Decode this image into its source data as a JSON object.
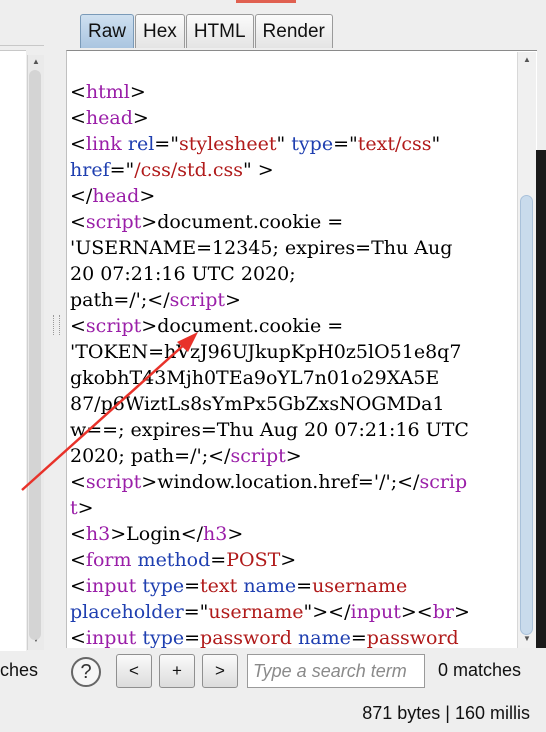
{
  "tabs": [
    {
      "label": "Raw",
      "active": true
    },
    {
      "label": "Hex",
      "active": false
    },
    {
      "label": "HTML",
      "active": false
    },
    {
      "label": "Render",
      "active": false
    }
  ],
  "code_lines": [
    [
      {
        "t": "<"
      },
      {
        "t": "html",
        "c": "tag"
      },
      {
        "t": ">"
      }
    ],
    [
      {
        "t": "<"
      },
      {
        "t": "head",
        "c": "tag"
      },
      {
        "t": ">"
      }
    ],
    [
      {
        "t": "<"
      },
      {
        "t": "link",
        "c": "tag"
      },
      {
        "t": " "
      },
      {
        "t": "rel",
        "c": "attr"
      },
      {
        "t": "=\""
      },
      {
        "t": "stylesheet",
        "c": "val"
      },
      {
        "t": "\" "
      },
      {
        "t": "type",
        "c": "attr"
      },
      {
        "t": "=\""
      },
      {
        "t": "text/css",
        "c": "val"
      },
      {
        "t": "\""
      }
    ],
    [
      {
        "t": "href",
        "c": "attr"
      },
      {
        "t": "=\""
      },
      {
        "t": "/css/std.css",
        "c": "val"
      },
      {
        "t": "\" >"
      }
    ],
    [
      {
        "t": "</"
      },
      {
        "t": "head",
        "c": "tag"
      },
      {
        "t": ">"
      }
    ],
    [
      {
        "t": "<"
      },
      {
        "t": "script",
        "c": "tag"
      },
      {
        "t": ">document.cookie ="
      }
    ],
    [
      {
        "t": "'USERNAME=12345; expires=Thu Aug"
      }
    ],
    [
      {
        "t": "20 07:21:16 UTC 2020;"
      }
    ],
    [
      {
        "t": "path=/';</"
      },
      {
        "t": "script",
        "c": "tag"
      },
      {
        "t": ">"
      }
    ],
    [
      {
        "t": "<"
      },
      {
        "t": "script",
        "c": "tag"
      },
      {
        "t": ">document.cookie ="
      }
    ],
    [
      {
        "t": "'TOKEN=hVzJ96UJkupKpH0z5lO51e8q7"
      }
    ],
    [
      {
        "t": "gkobhT43Mjh0TEa9oYL7n01o29XA5E"
      }
    ],
    [
      {
        "t": "87/p6WiztLs8sYmPx5GbZxsNOGMDa1"
      }
    ],
    [
      {
        "t": "w==; expires=Thu Aug 20 07:21:16 UTC"
      }
    ],
    [
      {
        "t": "2020; path=/';</"
      },
      {
        "t": "script",
        "c": "tag"
      },
      {
        "t": ">"
      }
    ],
    [
      {
        "t": "<"
      },
      {
        "t": "script",
        "c": "tag"
      },
      {
        "t": ">window.location.href='/';</"
      },
      {
        "t": "scrip",
        "c": "tag"
      }
    ],
    [
      {
        "t": "t",
        "c": "tag"
      },
      {
        "t": ">"
      }
    ],
    [
      {
        "t": "<"
      },
      {
        "t": "h3",
        "c": "tag"
      },
      {
        "t": ">Login</"
      },
      {
        "t": "h3",
        "c": "tag"
      },
      {
        "t": ">"
      }
    ],
    [
      {
        "t": "<"
      },
      {
        "t": "form",
        "c": "tag"
      },
      {
        "t": " "
      },
      {
        "t": "method",
        "c": "attr"
      },
      {
        "t": "="
      },
      {
        "t": "POST",
        "c": "val"
      },
      {
        "t": ">"
      }
    ],
    [
      {
        "t": "<"
      },
      {
        "t": "input",
        "c": "tag"
      },
      {
        "t": " "
      },
      {
        "t": "type",
        "c": "attr"
      },
      {
        "t": "="
      },
      {
        "t": "text",
        "c": "val"
      },
      {
        "t": " "
      },
      {
        "t": "name",
        "c": "attr"
      },
      {
        "t": "="
      },
      {
        "t": "username",
        "c": "val"
      }
    ],
    [
      {
        "t": "placeholder",
        "c": "attr"
      },
      {
        "t": "=\""
      },
      {
        "t": "username",
        "c": "val"
      },
      {
        "t": "\"></"
      },
      {
        "t": "input",
        "c": "tag"
      },
      {
        "t": "><"
      },
      {
        "t": "br",
        "c": "tag"
      },
      {
        "t": ">"
      }
    ],
    [
      {
        "t": "<"
      },
      {
        "t": "input",
        "c": "tag"
      },
      {
        "t": " "
      },
      {
        "t": "type",
        "c": "attr"
      },
      {
        "t": "="
      },
      {
        "t": "password",
        "c": "val"
      },
      {
        "t": " "
      },
      {
        "t": "name",
        "c": "attr"
      },
      {
        "t": "="
      },
      {
        "t": "password",
        "c": "val"
      }
    ]
  ],
  "search": {
    "help_label": "?",
    "prev_label": "<",
    "add_label": "+",
    "next_label": ">",
    "placeholder": "Type a search term",
    "matches": "0 matches"
  },
  "left_panel": {
    "matches_fragment": "ches"
  },
  "status": {
    "text": "871 bytes | 160 millis"
  },
  "colors": {
    "tag": "#9a1ea8",
    "attr": "#1f3fb0",
    "value": "#b01a1a",
    "arrow": "#e8322a"
  }
}
